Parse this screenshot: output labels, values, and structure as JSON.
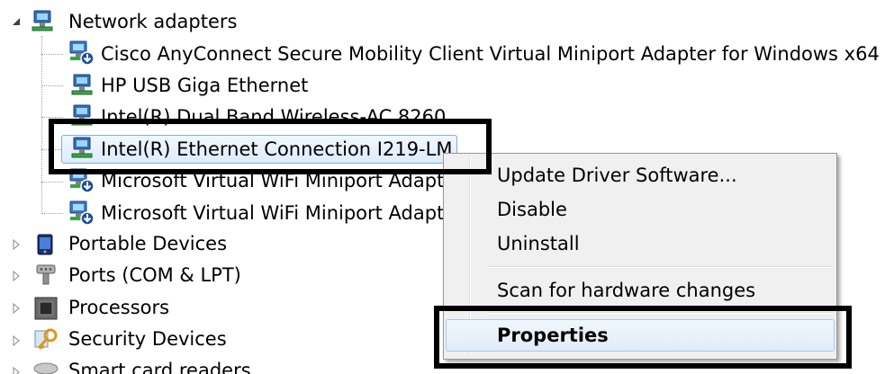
{
  "tree": {
    "category_network": {
      "label": "Network adapters"
    },
    "adapters": [
      {
        "label": "Cisco AnyConnect Secure Mobility Client Virtual Miniport Adapter for Windows x64"
      },
      {
        "label": "HP USB Giga Ethernet"
      },
      {
        "label": "Intel(R) Dual Band Wireless-AC 8260"
      },
      {
        "label": "Intel(R) Ethernet Connection I219-LM"
      },
      {
        "label": "Microsoft Virtual WiFi Miniport Adapter"
      },
      {
        "label": "Microsoft Virtual WiFi Miniport Adapter"
      }
    ],
    "categories": [
      {
        "label": "Portable Devices"
      },
      {
        "label": "Ports (COM & LPT)"
      },
      {
        "label": "Processors"
      },
      {
        "label": "Security Devices"
      },
      {
        "label": "Smart card readers"
      }
    ]
  },
  "context_menu": {
    "items": [
      {
        "label": "Update Driver Software..."
      },
      {
        "label": "Disable"
      },
      {
        "label": "Uninstall"
      },
      {
        "label": "Scan for hardware changes"
      },
      {
        "label": "Properties"
      }
    ]
  },
  "icons": {
    "network_adapter": "network-adapter-icon",
    "portable_devices": "portable-devices-icon",
    "ports": "ports-icon",
    "processor": "processor-icon",
    "security": "security-devices-icon",
    "smart_card": "smart-card-reader-icon"
  },
  "colors": {
    "selection_border": "#84acdd",
    "menu_background": "#f0f0f0",
    "callout": "#000000"
  }
}
